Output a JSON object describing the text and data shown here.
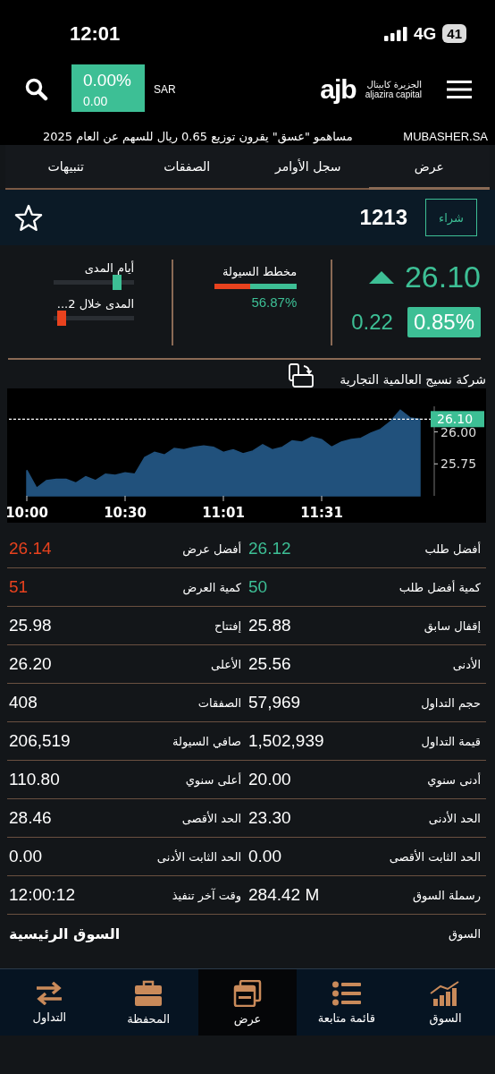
{
  "status_bar": {
    "time": "12:01",
    "network": "4G",
    "battery": "41"
  },
  "header": {
    "change_percent": "0.00%",
    "change_value": "0.00",
    "currency": "SAR",
    "logo_mark": "ajb",
    "logo_ar": "الجزيرة كابيتال",
    "logo_en": "aljazira capital"
  },
  "ticker": {
    "source": "MUBASHER.SA",
    "headline": "مساهمو \"عسق\" يقرون توزيع 0.65 ريال للسهم عن العام 2025"
  },
  "tabs": [
    {
      "label": "عرض",
      "selected": true
    },
    {
      "label": "سجل الأوامر",
      "selected": false
    },
    {
      "label": "الصفقات",
      "selected": false
    },
    {
      "label": "تنبيهات",
      "selected": false
    }
  ],
  "symbol": {
    "code": "1213",
    "buy_label": "شراء",
    "favorite": false
  },
  "quote": {
    "price": "26.10",
    "change": "0.22",
    "change_percent": "0.85%",
    "liquidity": {
      "label": "مخطط السيولة",
      "level": 0.5687,
      "reading": "56.87%"
    },
    "ranges": [
      {
        "label": "أيام المدى",
        "level": 0.85,
        "color": "#3dbf95"
      },
      {
        "label": "المدى خلال 2...",
        "level": 0.05,
        "color": "#e8421e"
      }
    ]
  },
  "chart": {
    "company": "شركة نسيج العالمية التجارية",
    "chart_data": {
      "type": "area",
      "categories": [
        "10:00",
        null,
        null,
        null,
        null,
        null,
        null,
        null,
        null,
        null,
        "10:30",
        null,
        null,
        null,
        null,
        null,
        null,
        null,
        null,
        null,
        "11:01",
        null,
        null,
        null,
        null,
        null,
        null,
        null,
        null,
        null,
        "11:31",
        null,
        null,
        null,
        null,
        null,
        null,
        null,
        null,
        null,
        null
      ],
      "series": [
        {
          "color": "#21517c",
          "values": [
            25.7,
            25.56,
            25.62,
            25.63,
            25.63,
            25.6,
            25.65,
            25.62,
            25.67,
            25.66,
            25.68,
            25.67,
            25.8,
            25.84,
            25.82,
            25.87,
            25.86,
            25.88,
            25.89,
            25.88,
            25.84,
            25.86,
            25.83,
            25.85,
            25.9,
            25.86,
            25.88,
            25.93,
            25.92,
            25.96,
            25.94,
            25.88,
            25.92,
            25.94,
            25.95,
            25.99,
            26.02,
            26.08,
            26.17,
            26.11,
            26.1
          ]
        }
      ],
      "ylim": [
        25.5,
        26.2
      ],
      "yticks": [
        {
          "value": 25.75,
          "label": "25.75"
        },
        {
          "value": 26.0,
          "label": "26.00"
        }
      ],
      "ref_lines": [
        {
          "axis": "y",
          "value": 26.1,
          "label": "26.10"
        }
      ]
    }
  },
  "stats": [
    {
      "kind": "pair",
      "cells": [
        {
          "label": "أفضل طلب",
          "value": "26.12",
          "color": "#3dbf95"
        },
        {
          "label": "أفضل عرض",
          "value": "26.14",
          "color": "#e8421e"
        }
      ]
    },
    {
      "kind": "pair",
      "cells": [
        {
          "label": "كمية أفضل طلب",
          "value": "50",
          "color": "#3dbf95"
        },
        {
          "label": "كمية العرض",
          "value": "51",
          "color": "#e8421e"
        }
      ]
    },
    {
      "kind": "pair",
      "cells": [
        {
          "label": "إقفال سابق",
          "value": "25.88"
        },
        {
          "label": "إفتتاح",
          "value": "25.98"
        }
      ]
    },
    {
      "kind": "pair",
      "cells": [
        {
          "label": "الأدنى",
          "value": "25.56"
        },
        {
          "label": "الأعلى",
          "value": "26.20"
        }
      ]
    },
    {
      "kind": "pair",
      "cells": [
        {
          "label": "حجم التداول",
          "value": "57,969"
        },
        {
          "label": "الصفقات",
          "value": "408"
        }
      ]
    },
    {
      "kind": "pair",
      "cells": [
        {
          "label": "قيمة التداول",
          "value": "1,502,939"
        },
        {
          "label": "صافي السيولة",
          "value": "206,519"
        }
      ]
    },
    {
      "kind": "pair",
      "cells": [
        {
          "label": "أدنى سنوي",
          "value": "20.00"
        },
        {
          "label": "أعلى سنوي",
          "value": "110.80"
        }
      ]
    },
    {
      "kind": "pair",
      "cells": [
        {
          "label": "الحد الأدنى",
          "value": "23.30"
        },
        {
          "label": "الحد الأقصى",
          "value": "28.46"
        }
      ]
    },
    {
      "kind": "pair",
      "cells": [
        {
          "label": "الحد الثابت الأقصى",
          "value": "0.00"
        },
        {
          "label": "الحد الثابت الأدنى",
          "value": "0.00"
        }
      ]
    },
    {
      "kind": "pair",
      "cells": [
        {
          "label": "رسملة السوق",
          "value": "284.42 M"
        },
        {
          "label": "وقت آخر تنفيذ",
          "value": "12:00:12"
        }
      ]
    },
    {
      "kind": "wide",
      "cells": [
        {
          "label": "السوق",
          "value": "السوق الرئيسية"
        }
      ]
    }
  ],
  "bottom_nav": [
    {
      "label": "السوق",
      "selected": false
    },
    {
      "label": "قائمة متابعة",
      "selected": false
    },
    {
      "label": "عرض",
      "selected": true
    },
    {
      "label": "المحفظة",
      "selected": false
    },
    {
      "label": "التداول",
      "selected": false
    }
  ]
}
